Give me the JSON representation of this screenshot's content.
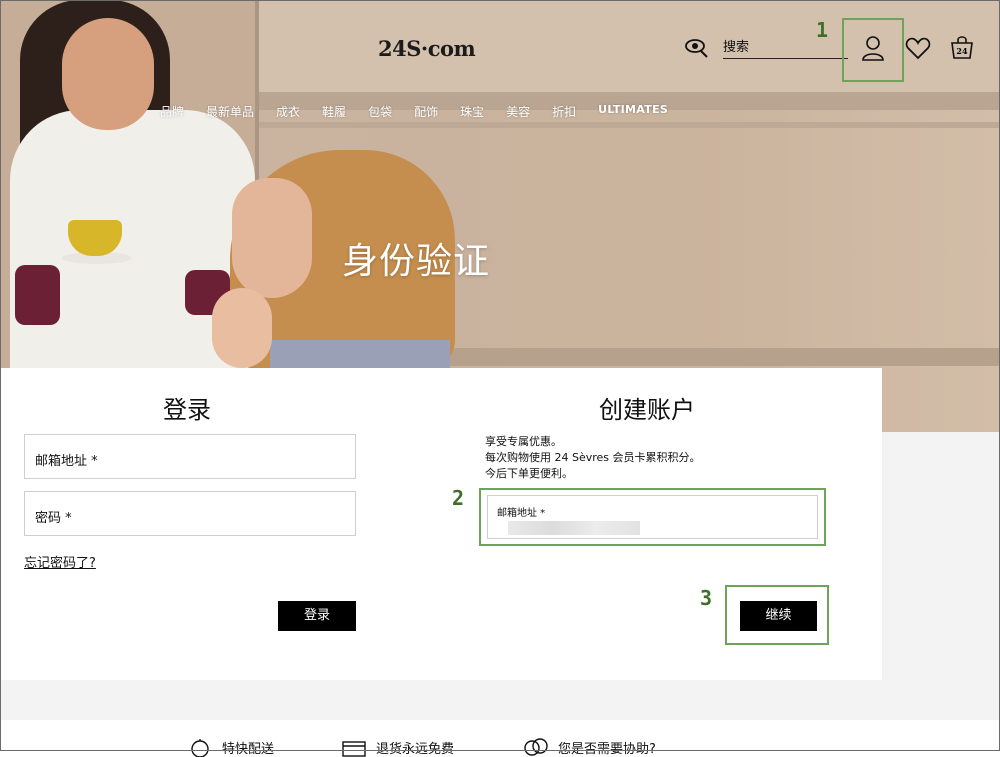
{
  "header": {
    "logo": "24S·com",
    "search_placeholder": "搜索",
    "icons": [
      "eye-icon",
      "user-icon",
      "heart-icon",
      "bag-icon"
    ]
  },
  "nav": {
    "items": [
      "品牌",
      "最新单品",
      "成衣",
      "鞋履",
      "包袋",
      "配饰",
      "珠宝",
      "美容",
      "折扣",
      "ULTIMATES"
    ]
  },
  "hero": {
    "title": "身份验证"
  },
  "login": {
    "heading": "登录",
    "email_label": "邮箱地址 *",
    "password_label": "密码 *",
    "forgot": "忘记密码了?",
    "button": "登录"
  },
  "register": {
    "heading": "创建账户",
    "benefits": [
      "享受专属优惠。",
      "每次购物使用 24 Sèvres 会员卡累积积分。",
      "今后下单更便利。"
    ],
    "email_label": "邮箱地址 *",
    "button": "继续"
  },
  "annotations": {
    "step1": "1",
    "step2": "2",
    "step3": "3",
    "color": "#6fa35a"
  },
  "footer": {
    "items": [
      "特快配送",
      "退货永远免费",
      "您是否需要协助?"
    ]
  }
}
